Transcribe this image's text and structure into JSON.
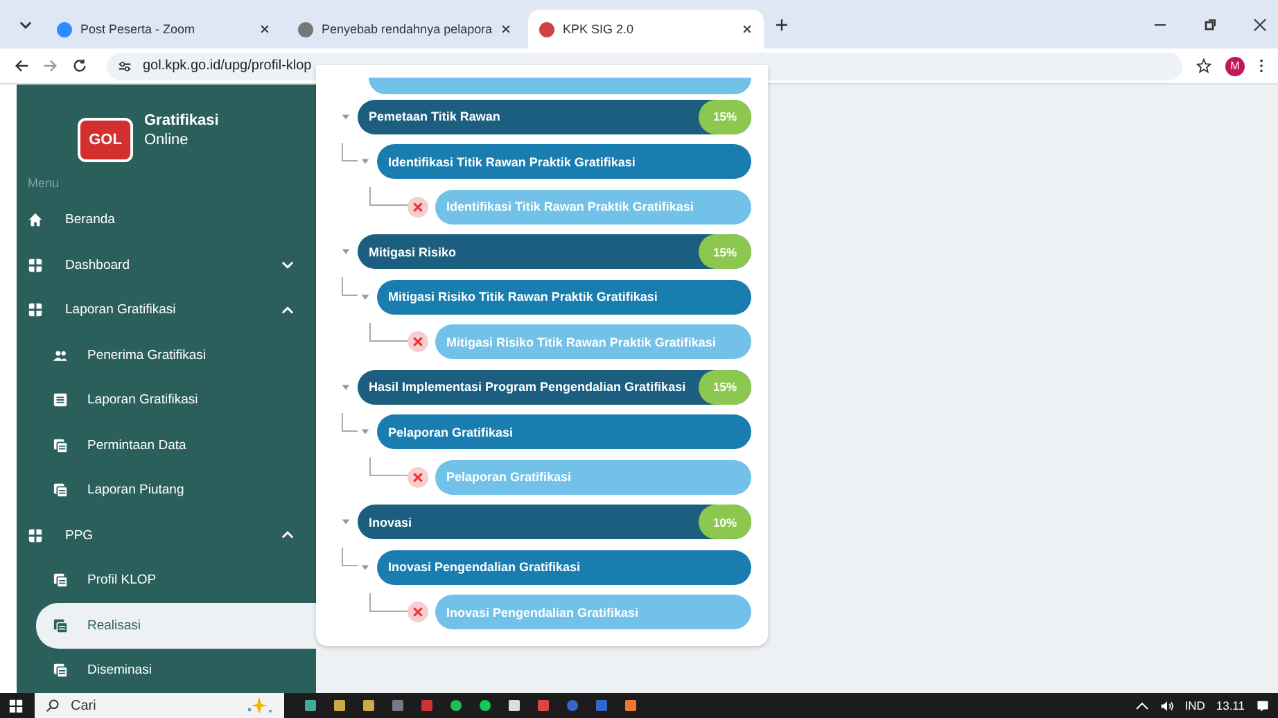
{
  "browser": {
    "tabs": [
      {
        "title": "Post Peserta - Zoom",
        "selected": false
      },
      {
        "title": "Penyebab rendahnya pelapora",
        "selected": false
      },
      {
        "title": "KPK SIG 2.0",
        "selected": true
      }
    ],
    "url": "gol.kpk.go.id/upg/profil-klop",
    "avatar": "M"
  },
  "sidebar": {
    "brand": {
      "title": "Gratifikasi",
      "subtitle": "Online",
      "logo": "GOL"
    },
    "menu_label": "Menu",
    "items": [
      {
        "label": "Beranda",
        "selected": false
      },
      {
        "label": "Dashboard",
        "expanded": false,
        "selected": false
      },
      {
        "label": "Laporan Gratifikasi",
        "expanded": true,
        "selected": false,
        "children": [
          {
            "label": "Penerima Gratifikasi",
            "selected": false
          },
          {
            "label": "Laporan Gratifikasi",
            "selected": false
          },
          {
            "label": "Permintaan Data",
            "selected": false
          },
          {
            "label": "Laporan Piutang",
            "selected": false
          }
        ]
      },
      {
        "label": "PPG",
        "expanded": true,
        "selected": false,
        "children": [
          {
            "label": "Profil KLOP",
            "selected": false
          },
          {
            "label": "Realisasi",
            "selected": true
          },
          {
            "label": "Diseminasi",
            "selected": false
          }
        ]
      }
    ]
  },
  "tree": [
    {
      "title": "Pemetaan Titik Rawan",
      "percent": "15%",
      "expanded": true,
      "children": [
        {
          "title": "Identifikasi Titik Rawan Praktik Gratifikasi",
          "expanded": true,
          "children": [
            {
              "title": "Identifikasi Titik Rawan Praktik Gratifikasi",
              "done": false
            }
          ]
        }
      ]
    },
    {
      "title": "Mitigasi Risiko",
      "percent": "15%",
      "expanded": true,
      "children": [
        {
          "title": "Mitigasi Risiko Titik Rawan Praktik Gratifikasi",
          "expanded": true,
          "children": [
            {
              "title": "Mitigasi Risiko Titik Rawan Praktik Gratifikasi",
              "done": false
            }
          ]
        }
      ]
    },
    {
      "title": "Hasil Implementasi Program Pengendalian Gratifikasi",
      "percent": "15%",
      "expanded": true,
      "children": [
        {
          "title": "Pelaporan Gratifikasi",
          "expanded": true,
          "children": [
            {
              "title": "Pelaporan Gratifikasi",
              "done": false
            }
          ]
        }
      ]
    },
    {
      "title": "Inovasi",
      "percent": "10%",
      "expanded": true,
      "children": [
        {
          "title": "Inovasi Pengendalian Gratifikasi",
          "expanded": true,
          "children": [
            {
              "title": "Inovasi Pengendalian Gratifikasi",
              "done": false
            }
          ]
        }
      ]
    }
  ],
  "taskbar": {
    "search": "Cari",
    "language": "IND",
    "time": "13.11"
  }
}
